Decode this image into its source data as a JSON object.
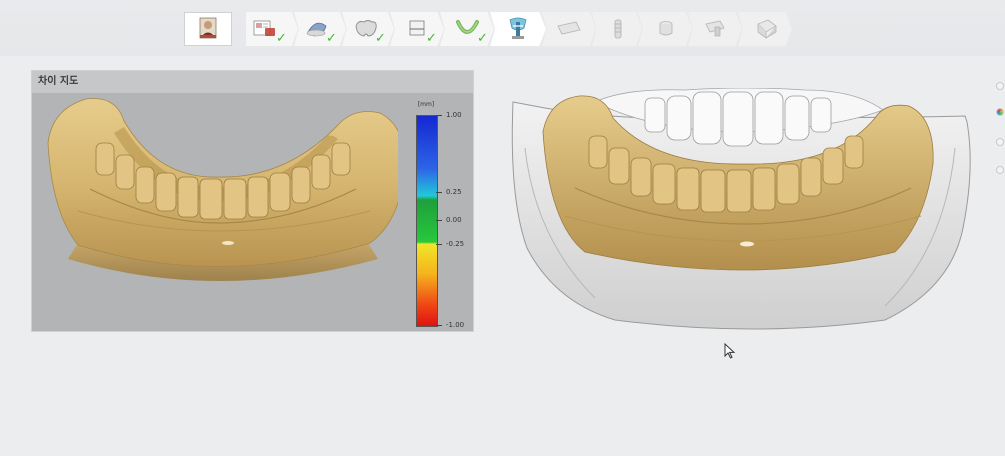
{
  "workflow": {
    "steps": [
      {
        "name": "scan-data",
        "state": "done"
      },
      {
        "name": "scan-align",
        "state": "done"
      },
      {
        "name": "tooth-form",
        "state": "done"
      },
      {
        "name": "arch-plane",
        "state": "done"
      },
      {
        "name": "arch-curve",
        "state": "done"
      },
      {
        "name": "implant-plan",
        "state": "active"
      },
      {
        "name": "guide-design",
        "state": "pending"
      },
      {
        "name": "sleeve",
        "state": "pending"
      },
      {
        "name": "guide-support",
        "state": "pending"
      },
      {
        "name": "guide-output",
        "state": "pending"
      },
      {
        "name": "export",
        "state": "pending"
      }
    ],
    "check_glyph": "✓"
  },
  "deviation_panel": {
    "title": "차이 지도",
    "unit": "[mm]",
    "scale_ticks": [
      "1.00",
      "0.25",
      "0.00",
      "-0.25",
      "-1.00"
    ],
    "colors": {
      "model": "#d9bd7c",
      "background": "#b3b4b6"
    }
  },
  "icons": {
    "home": "patient-photo-icon",
    "cursor": "mouse-pointer-icon"
  }
}
